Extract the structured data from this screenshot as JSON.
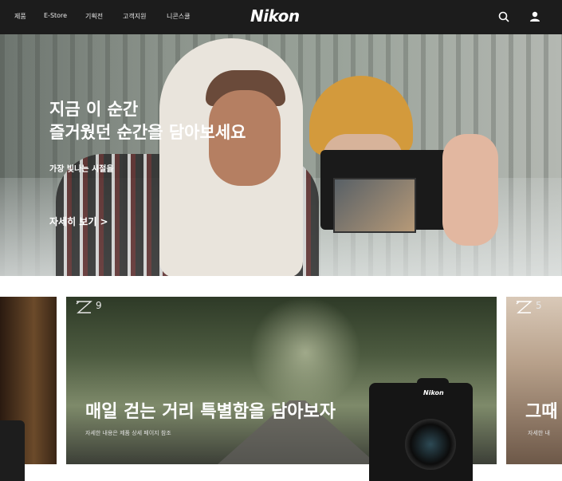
{
  "nav": {
    "items": [
      "제품",
      "E-Store",
      "기획전",
      "고객지원",
      "니콘스쿨"
    ],
    "logo": "Nikon"
  },
  "hero": {
    "title_line1": "지금 이 순간",
    "title_line2": "즐거웠던 순간을 담아보세요",
    "subtitle": "가장 빛나는 시절을",
    "cta": "자세히 보기  >"
  },
  "cards": {
    "main": {
      "badge_num": "9",
      "title": "매일 걷는 거리 특별함을 담아보자",
      "subtitle": "자세한 내용은 제품 상세 페이지 참조",
      "camera_brand": "Nikon"
    },
    "right": {
      "badge_num": "5",
      "title": "그때",
      "subtitle": "자세한 내"
    }
  }
}
